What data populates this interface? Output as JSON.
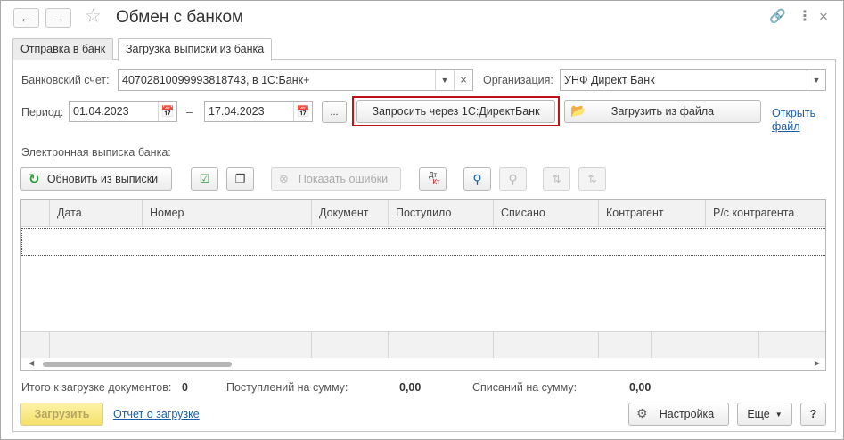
{
  "window": {
    "title": "Обмен с банком",
    "icons": [
      "back-arrow-icon",
      "forward-arrow-icon",
      "favorite-star-icon",
      "link-icon",
      "more-vertical-icon",
      "close-icon"
    ]
  },
  "tabs": [
    {
      "label": "Отправка в банк",
      "active": false
    },
    {
      "label": "Загрузка выписки из банка",
      "active": true
    }
  ],
  "form": {
    "bank_account_label": "Банковский счет:",
    "bank_account_value": "40702810099993818743, в 1С:Банк+",
    "organization_label": "Организация:",
    "organization_value": "УНФ Директ Банк",
    "period_label": "Период:",
    "period_from": "01.04.2023",
    "period_dash": "–",
    "period_to": "17.04.2023",
    "period_more": "...",
    "request_button": "Запросить через 1С:ДиректБанк",
    "load_file_button": "Загрузить из файла",
    "open_file_link_line1": "Открыть",
    "open_file_link_line2": "файл"
  },
  "statement": {
    "section_label": "Электронная выписка банка:",
    "refresh_button": "Обновить из выписки",
    "show_errors_button": "Показать ошибки",
    "dt_kt": {
      "top": "Дт",
      "bottom": "Кт"
    }
  },
  "table": {
    "columns": [
      "Дата",
      "Номер",
      "Документ",
      "Поступило",
      "Списано",
      "Контрагент",
      "Р/с контрагента"
    ],
    "rows": []
  },
  "totals": {
    "docs_label": "Итого к загрузке документов:",
    "docs_value": "0",
    "income_label": "Поступлений на сумму:",
    "income_value": "0,00",
    "expense_label": "Списаний на сумму:",
    "expense_value": "0,00"
  },
  "footer": {
    "load_button": "Загрузить",
    "report_link": "Отчет о загрузке",
    "settings_button": "Настройка",
    "more_button": "Еще",
    "help_button": "?"
  },
  "colors": {
    "highlight_border": "#c1121c",
    "link": "#1c5fa8",
    "refresh_icon": "#2e9b3a",
    "load_button_bg": "#f4e06a"
  }
}
